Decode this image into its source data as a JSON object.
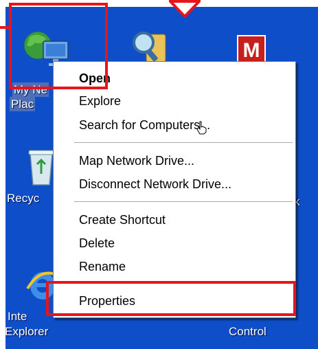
{
  "desktop": {
    "background_color": "#0e4ec9",
    "icons": {
      "my_network_places": {
        "label_line1": "My Ne",
        "label_line2": "Plac",
        "icon": "network-globe-icon"
      },
      "search": {
        "icon": "search-magnifier-icon"
      },
      "mcafee": {
        "icon": "mcafee-m-icon",
        "letter": "M"
      },
      "recycle_bin": {
        "label": "Recyc",
        "icon": "recycle-bin-icon"
      },
      "partial_right": {
        "label": "k"
      },
      "internet_explorer": {
        "label_line1": "Inte",
        "label_line2": "Explorer",
        "icon": "internet-explorer-icon"
      },
      "control_panel": {
        "label": "Control"
      }
    }
  },
  "context_menu": {
    "items": [
      {
        "label": "Open",
        "default": true
      },
      {
        "label": "Explore"
      },
      {
        "label": "Search for Computers..."
      },
      {
        "label": "Map Network Drive..."
      },
      {
        "label": "Disconnect Network Drive..."
      },
      {
        "label": "Create Shortcut"
      },
      {
        "label": "Delete"
      },
      {
        "label": "Rename"
      },
      {
        "label": "Properties"
      }
    ]
  },
  "annotation_color": "#e8141b"
}
